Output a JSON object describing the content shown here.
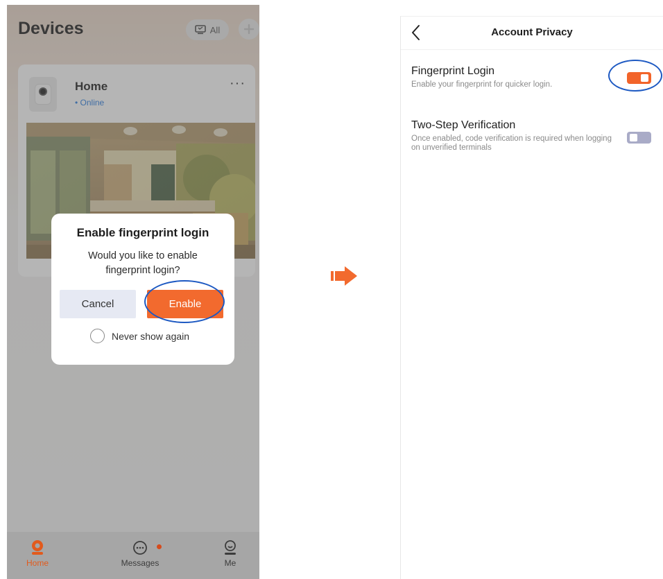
{
  "left_screen": {
    "title": "Devices",
    "filter_label": "All",
    "device": {
      "name": "Home",
      "status": "• Online"
    },
    "dialog": {
      "title": "Enable fingerprint login",
      "message": "Would you like to enable fingerprint login?",
      "cancel_label": "Cancel",
      "enable_label": "Enable",
      "never_show_label": "Never show again"
    },
    "tabs": [
      {
        "label": "Home",
        "icon": "home-camera-icon",
        "active": true
      },
      {
        "label": "Messages",
        "icon": "chat-bubble-icon",
        "active": false,
        "badge": true
      },
      {
        "label": "Me",
        "icon": "person-icon",
        "active": false
      }
    ]
  },
  "right_screen": {
    "title": "Account Privacy",
    "settings": [
      {
        "title": "Fingerprint Login",
        "description": "Enable your fingerprint for quicker login.",
        "enabled": true
      },
      {
        "title": "Two-Step Verification",
        "description": "Once enabled, code verification is required when logging on unverified terminals",
        "enabled": false
      }
    ]
  },
  "colors": {
    "accent": "#F26A2E",
    "highlight_ring": "#1D59C2",
    "toggle_off": "#A9ABC7",
    "online": "#2A7DE1"
  }
}
